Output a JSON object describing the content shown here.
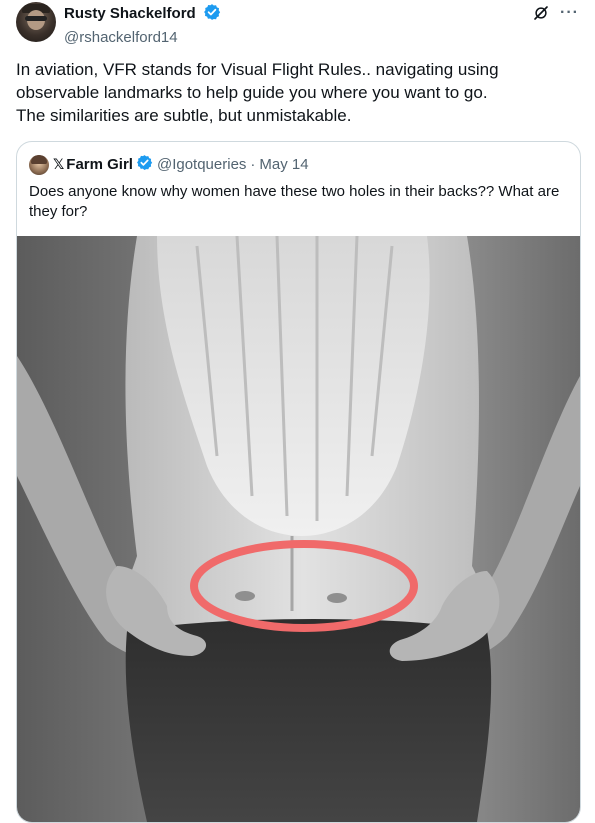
{
  "tweet": {
    "author": {
      "display_name": "Rusty Shackelford",
      "handle": "@rshackelford14",
      "verified": true
    },
    "text_lines": [
      "In aviation, VFR stands for Visual Flight Rules.. navigating using",
      "observable landmarks to help guide you where you want to go.",
      "The similarities are subtle, but unmistakable."
    ],
    "icons": {
      "grok": "grok-icon",
      "more": "more-icon"
    },
    "more_label": "···"
  },
  "quote": {
    "x_mark": "𝕏",
    "display_name": "Farm Girl",
    "handle": "@Igotqueries",
    "separator": "·",
    "date": "May 14",
    "text": "Does anyone know why women have these two holes in their backs?? What are they for?",
    "photo": {
      "subject": "black-and-white photo of a woman's lower back with hands on hips",
      "highlight_color": "#f06a6a"
    }
  },
  "colors": {
    "text_primary": "#0f1419",
    "text_secondary": "#536471",
    "verified_blue": "#1d9bf0",
    "border": "#cfd9de"
  }
}
